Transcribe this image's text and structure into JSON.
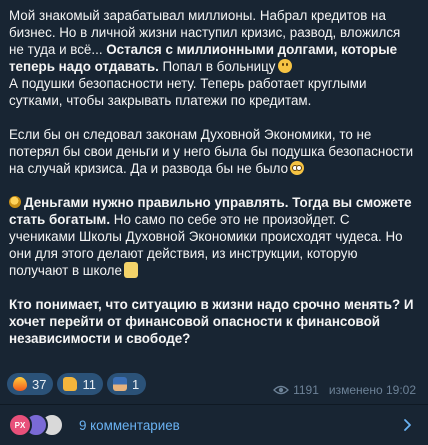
{
  "post": {
    "p1_a": "Мой знакомый зарабатывал миллионы. Набрал кредитов на бизнес. Но в личной жизни наступил кризис, развод, вложился не туда и всё... ",
    "p1_b": "Остался с миллионными долгами, которые теперь надо отдавать.",
    "p1_c": " Попал в больницу",
    "p1_d": "А подушки безопасности нету. Теперь работает круглыми сутками, чтобы закрывать платежи по кредитам.",
    "p2": "Если бы он следовал законам Духовной Экономики, то не потерял бы свои деньги и у него была бы подушка безопасности на случай кризиса. Да и развода бы не было",
    "p3_a": "Деньгами нужно правильно управлять. Тогда вы сможете стать богатым.",
    "p3_b": " Но само по себе это не произойдет. С учениками Школы Духовной Экономики происходят чудеса. Но они для этого делают действия, из инструкции, которую получают в школе",
    "p4": "Кто понимает, что ситуацию в жизни надо срочно менять? И хочет перейти от финансовой опасности к финансовой независимости и свободе?"
  },
  "reactions": [
    {
      "icon": "fire-icon",
      "count": "37"
    },
    {
      "icon": "thumbs-up-icon",
      "count": "11"
    },
    {
      "icon": "person-raising-hands-icon",
      "count": "1"
    }
  ],
  "meta": {
    "views": "1191",
    "edited_time": "изменено 19:02"
  },
  "comments": {
    "avatar_initials": "PX",
    "label": "9 комментариев"
  },
  "colors": {
    "background": "#182533",
    "link": "#6ab2f2",
    "reaction_bg": "#2b5278",
    "meta_text": "#6d8297"
  }
}
